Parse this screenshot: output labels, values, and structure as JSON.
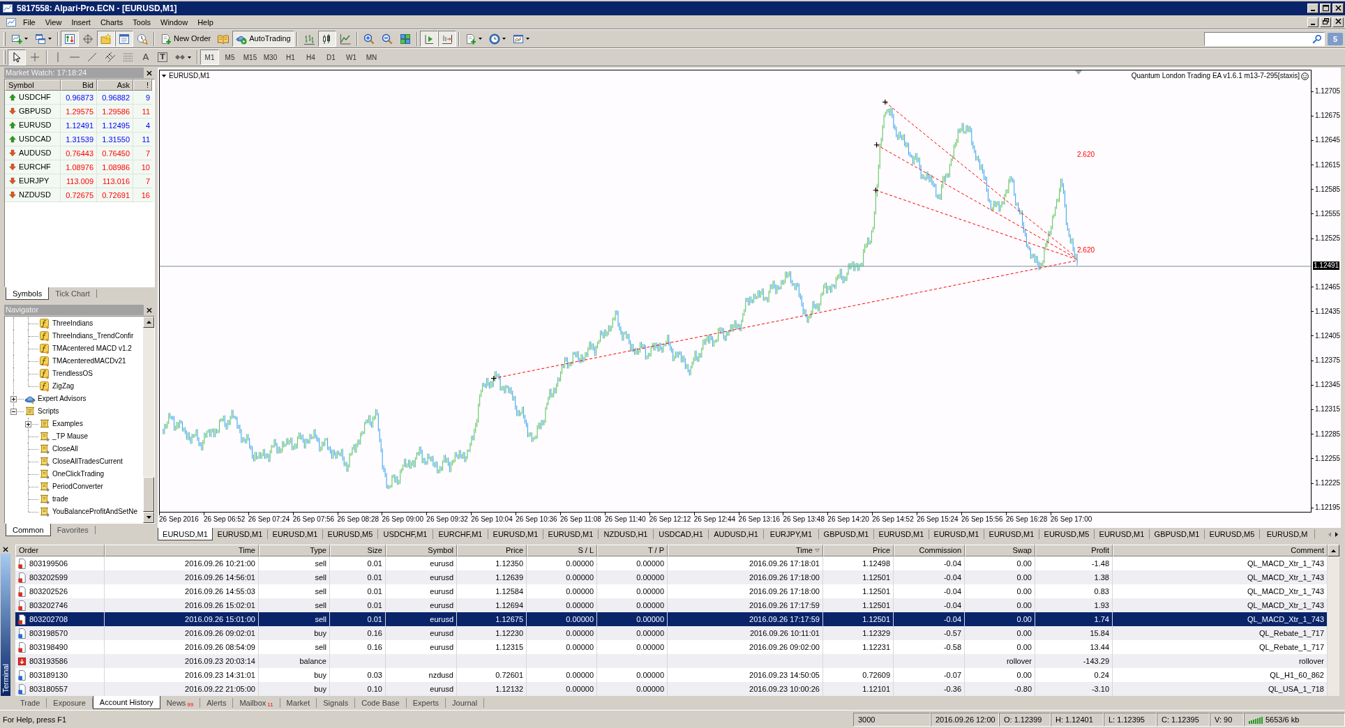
{
  "window": {
    "title": "5817558: Alpari-Pro.ECN - [EURUSD,M1]"
  },
  "menu": [
    "File",
    "View",
    "Insert",
    "Charts",
    "Tools",
    "Window",
    "Help"
  ],
  "toolbar_main": [
    [
      {
        "kind": "icon",
        "pressed": false,
        "dropdown": true
      },
      {
        "kind": "icon",
        "pressed": false,
        "dropdown": true
      }
    ],
    [
      {
        "kind": "icon",
        "pressed": true
      },
      {
        "kind": "icon",
        "pressed": false
      },
      {
        "kind": "icon",
        "pressed": true
      },
      {
        "kind": "icon",
        "pressed": true
      },
      {
        "kind": "icon",
        "pressed": false
      }
    ],
    [
      {
        "kind": "icon_text",
        "label": "New Order",
        "pressed": false
      },
      {
        "kind": "icon",
        "pressed": false
      },
      {
        "kind": "icon_text",
        "label": "AutoTrading",
        "pressed": true
      }
    ],
    [
      {
        "kind": "icon",
        "pressed": false
      },
      {
        "kind": "icon",
        "pressed": true
      },
      {
        "kind": "icon",
        "pressed": false
      }
    ],
    [
      {
        "kind": "icon",
        "pressed": false
      },
      {
        "kind": "icon",
        "pressed": false
      },
      {
        "kind": "icon",
        "pressed": false
      }
    ],
    [
      {
        "kind": "icon",
        "pressed": true
      },
      {
        "kind": "icon",
        "pressed": true
      }
    ],
    [
      {
        "kind": "icon",
        "pressed": false,
        "dropdown": true
      },
      {
        "kind": "icon",
        "pressed": false,
        "dropdown": true
      },
      {
        "kind": "icon",
        "pressed": false,
        "dropdown": true
      }
    ]
  ],
  "toolbar_draw": [
    [
      {
        "kind": "icon",
        "pressed": true
      },
      {
        "kind": "icon",
        "pressed": false
      }
    ],
    [
      {
        "kind": "icon",
        "pressed": false
      },
      {
        "kind": "icon",
        "pressed": false
      },
      {
        "kind": "icon",
        "pressed": false
      },
      {
        "kind": "icon",
        "pressed": false
      },
      {
        "kind": "icon",
        "pressed": false
      },
      {
        "kind": "glyph",
        "label": "A",
        "pressed": false
      },
      {
        "kind": "framed_glyph",
        "label": "T",
        "pressed": false
      },
      {
        "kind": "icon",
        "pressed": false,
        "dropdown": true
      }
    ]
  ],
  "timeframes": [
    {
      "label": "M1",
      "selected": true
    },
    {
      "label": "M5",
      "selected": false
    },
    {
      "label": "M15",
      "selected": false
    },
    {
      "label": "M30",
      "selected": false
    },
    {
      "label": "H1",
      "selected": false
    },
    {
      "label": "H4",
      "selected": false
    },
    {
      "label": "D1",
      "selected": false
    },
    {
      "label": "W1",
      "selected": false
    },
    {
      "label": "MN",
      "selected": false
    }
  ],
  "messages_count": "5",
  "market_watch": {
    "title": "Market Watch: 17:18:24",
    "columns": [
      "Symbol",
      "Bid",
      "Ask",
      "!"
    ],
    "rows": [
      {
        "symbol": "USDCHF",
        "bid": "0.96873",
        "ask": "0.96882",
        "spread": "9",
        "rising": true
      },
      {
        "symbol": "GBPUSD",
        "bid": "1.29575",
        "ask": "1.29586",
        "spread": "11",
        "rising": false
      },
      {
        "symbol": "EURUSD",
        "bid": "1.12491",
        "ask": "1.12495",
        "spread": "4",
        "rising": true
      },
      {
        "symbol": "USDCAD",
        "bid": "1.31539",
        "ask": "1.31550",
        "spread": "11",
        "rising": true
      },
      {
        "symbol": "AUDUSD",
        "bid": "0.76443",
        "ask": "0.76450",
        "spread": "7",
        "rising": false
      },
      {
        "symbol": "EURCHF",
        "bid": "1.08976",
        "ask": "1.08986",
        "spread": "10",
        "rising": false
      },
      {
        "symbol": "EURJPY",
        "bid": "113.009",
        "ask": "113.016",
        "spread": "7",
        "rising": false
      },
      {
        "symbol": "NZDUSD",
        "bid": "0.72675",
        "ask": "0.72691",
        "spread": "16",
        "rising": false
      }
    ],
    "tabs": [
      {
        "label": "Symbols",
        "selected": true
      },
      {
        "label": "Tick Chart",
        "selected": false
      }
    ]
  },
  "navigator": {
    "title": "Navigator",
    "tree": [
      {
        "children": [
          {
            "label": "ThreeIndians",
            "kind": "indicator"
          },
          {
            "label": "ThreeIndians_TrendConfir",
            "kind": "indicator"
          },
          {
            "label": "TMAcentered MACD v1.2",
            "kind": "indicator"
          },
          {
            "label": "TMAcenteredMACDv21",
            "kind": "indicator"
          },
          {
            "label": "TrendlessOS",
            "kind": "indicator"
          },
          {
            "label": "ZigZag",
            "kind": "indicator"
          }
        ]
      },
      {
        "label": "Expert Advisors",
        "kind": "experts",
        "expanded": false
      },
      {
        "label": "Scripts",
        "kind": "folder",
        "expanded": true,
        "children": [
          {
            "label": "Examples",
            "kind": "folder",
            "expanded": false
          },
          {
            "label": "_TP Mause",
            "kind": "script"
          },
          {
            "label": "CloseAll",
            "kind": "script"
          },
          {
            "label": "CloseAllTradesCurrent",
            "kind": "script"
          },
          {
            "label": "OneClickTrading",
            "kind": "script"
          },
          {
            "label": "PeriodConverter",
            "kind": "script"
          },
          {
            "label": "trade",
            "kind": "script"
          },
          {
            "label": "YouBalanceProfitAndSetNe",
            "kind": "script"
          }
        ]
      }
    ],
    "tabs": [
      {
        "label": "Common",
        "selected": true
      },
      {
        "label": "Favorites",
        "selected": false
      }
    ]
  },
  "chart": {
    "symbol_label": "EURUSD,M1",
    "ea_label": "Quantum London Trading EA v1.6.1 m13-7-295[staxis]",
    "price_labels_above": [
      "1.12705",
      "1.12675",
      "1.12645",
      "1.12615",
      "1.12585",
      "1.12555",
      "1.12525"
    ],
    "bid_label": "1.12491",
    "price_labels_below": [
      "1.12465",
      "1.12435",
      "1.12405",
      "1.12375",
      "1.12345",
      "1.12315",
      "1.12285",
      "1.12255",
      "1.12225",
      "1.12195"
    ],
    "time_labels": [
      "26 Sep 2016",
      "26 Sep 06:52",
      "26 Sep 07:24",
      "26 Sep 07:56",
      "26 Sep 08:28",
      "26 Sep 09:00",
      "26 Sep 09:32",
      "26 Sep 10:04",
      "26 Sep 10:36",
      "26 Sep 11:08",
      "26 Sep 11:40",
      "26 Sep 12:12",
      "26 Sep 12:44",
      "26 Sep 13:16",
      "26 Sep 13:48",
      "26 Sep 14:20",
      "26 Sep 14:52",
      "26 Sep 15:24",
      "26 Sep 15:56",
      "26 Sep 16:28",
      "26 Sep 17:00"
    ],
    "fibo_labels": [
      "2.620",
      "2.620"
    ]
  },
  "chart_tabs": [
    {
      "label": "EURUSD,M1",
      "selected": true
    },
    {
      "label": "EURUSD,M1",
      "selected": false
    },
    {
      "label": "EURUSD,M1",
      "selected": false
    },
    {
      "label": "EURUSD,M5",
      "selected": false
    },
    {
      "label": "USDCHF,M1",
      "selected": false
    },
    {
      "label": "EURCHF,M1",
      "selected": false
    },
    {
      "label": "EURUSD,M1",
      "selected": false
    },
    {
      "label": "EURUSD,M1",
      "selected": false
    },
    {
      "label": "NZDUSD,H1",
      "selected": false
    },
    {
      "label": "USDCAD,H1",
      "selected": false
    },
    {
      "label": "AUDUSD,H1",
      "selected": false
    },
    {
      "label": "EURJPY,M1",
      "selected": false
    },
    {
      "label": "GBPUSD,M1",
      "selected": false
    },
    {
      "label": "EURUSD,M1",
      "selected": false
    },
    {
      "label": "EURUSD,M1",
      "selected": false
    },
    {
      "label": "EURUSD,M1",
      "selected": false
    },
    {
      "label": "EURUSD,M5",
      "selected": false
    },
    {
      "label": "EURUSD,M1",
      "selected": false
    },
    {
      "label": "GBPUSD,M1",
      "selected": false
    },
    {
      "label": "EURUSD,M5",
      "selected": false
    },
    {
      "label": "EURUSD,M",
      "selected": false
    }
  ],
  "terminal": {
    "side_label": "Terminal",
    "columns": [
      {
        "label": "Order",
        "sorted": false
      },
      {
        "label": "Time",
        "sorted": false
      },
      {
        "label": "Type",
        "sorted": false
      },
      {
        "label": "Size",
        "sorted": false
      },
      {
        "label": "Symbol",
        "sorted": false
      },
      {
        "label": "Price",
        "sorted": false
      },
      {
        "label": "S / L",
        "sorted": false
      },
      {
        "label": "T / P",
        "sorted": false
      },
      {
        "label": "Time",
        "sorted": true
      },
      {
        "label": "Price",
        "sorted": false
      },
      {
        "label": "Commission",
        "sorted": false
      },
      {
        "label": "Swap",
        "sorted": false
      },
      {
        "label": "Profit",
        "sorted": false
      },
      {
        "label": "Comment",
        "sorted": false
      }
    ],
    "rows": [
      {
        "kind": "sell",
        "selected": false,
        "cells": [
          "803199506",
          "2016.09.26 10:21:00",
          "sell",
          "0.01",
          "eurusd",
          "1.12350",
          "0.00000",
          "0.00000",
          "2016.09.26 17:18:01",
          "1.12498",
          "-0.04",
          "0.00",
          "-1.48",
          "QL_MACD_Xtr_1_743"
        ]
      },
      {
        "kind": "sell",
        "selected": false,
        "cells": [
          "803202599",
          "2016.09.26 14:56:01",
          "sell",
          "0.01",
          "eurusd",
          "1.12639",
          "0.00000",
          "0.00000",
          "2016.09.26 17:18:00",
          "1.12501",
          "-0.04",
          "0.00",
          "1.38",
          "QL_MACD_Xtr_1_743"
        ]
      },
      {
        "kind": "sell",
        "selected": false,
        "cells": [
          "803202526",
          "2016.09.26 14:55:03",
          "sell",
          "0.01",
          "eurusd",
          "1.12584",
          "0.00000",
          "0.00000",
          "2016.09.26 17:18:00",
          "1.12501",
          "-0.04",
          "0.00",
          "0.83",
          "QL_MACD_Xtr_1_743"
        ]
      },
      {
        "kind": "sell",
        "selected": false,
        "cells": [
          "803202746",
          "2016.09.26 15:02:01",
          "sell",
          "0.01",
          "eurusd",
          "1.12694",
          "0.00000",
          "0.00000",
          "2016.09.26 17:17:59",
          "1.12501",
          "-0.04",
          "0.00",
          "1.93",
          "QL_MACD_Xtr_1_743"
        ]
      },
      {
        "kind": "sell",
        "selected": true,
        "cells": [
          "803202708",
          "2016.09.26 15:01:00",
          "sell",
          "0.01",
          "eurusd",
          "1.12675",
          "0.00000",
          "0.00000",
          "2016.09.26 17:17:59",
          "1.12501",
          "-0.04",
          "0.00",
          "1.74",
          "QL_MACD_Xtr_1_743"
        ]
      },
      {
        "kind": "buy",
        "selected": false,
        "cells": [
          "803198570",
          "2016.09.26 09:02:01",
          "buy",
          "0.16",
          "eurusd",
          "1.12230",
          "0.00000",
          "0.00000",
          "2016.09.26 10:11:01",
          "1.12329",
          "-0.57",
          "0.00",
          "15.84",
          "QL_Rebate_1_717"
        ]
      },
      {
        "kind": "sell",
        "selected": false,
        "cells": [
          "803198490",
          "2016.09.26 08:54:09",
          "sell",
          "0.16",
          "eurusd",
          "1.12315",
          "0.00000",
          "0.00000",
          "2016.09.26 09:02:00",
          "1.12231",
          "-0.58",
          "0.00",
          "13.44",
          "QL_Rebate_1_717"
        ]
      },
      {
        "kind": "balance",
        "selected": false,
        "cells": [
          "803193586",
          "2016.09.23 20:03:14",
          "balance",
          null,
          null,
          null,
          null,
          null,
          null,
          null,
          null,
          "rollover",
          "-143.29",
          "rollover"
        ]
      },
      {
        "kind": "buy",
        "selected": false,
        "cells": [
          "803189130",
          "2016.09.23 14:31:01",
          "buy",
          "0.03",
          "nzdusd",
          "0.72601",
          "0.00000",
          "0.00000",
          "2016.09.23 14:50:05",
          "0.72609",
          "-0.07",
          "0.00",
          "0.24",
          "QL_H1_60_862"
        ]
      },
      {
        "kind": "buy",
        "selected": false,
        "cells": [
          "803180557",
          "2016.09.22 21:05:00",
          "buy",
          "0.10",
          "eurusd",
          "1.12132",
          "0.00000",
          "0.00000",
          "2016.09.23 10:00:26",
          "1.12101",
          "-0.36",
          "-0.80",
          "-3.10",
          "QL_USA_1_718"
        ]
      }
    ],
    "tabs": [
      {
        "label": "Trade",
        "selected": false
      },
      {
        "label": "Exposure",
        "selected": false
      },
      {
        "label": "Account History",
        "selected": true
      },
      {
        "label": "News",
        "badge": "99",
        "selected": false
      },
      {
        "label": "Alerts",
        "selected": false
      },
      {
        "label": "Mailbox",
        "badge": "11",
        "selected": false
      },
      {
        "label": "Market",
        "selected": false
      },
      {
        "label": "Signals",
        "selected": false
      },
      {
        "label": "Code Base",
        "selected": false
      },
      {
        "label": "Experts",
        "selected": false
      },
      {
        "label": "Journal",
        "selected": false
      }
    ]
  },
  "status_bar": {
    "help": "For Help, press F1",
    "panes": [
      "3000",
      "2016.09.26 12:00",
      "O: 1.12399",
      "H: 1.12401",
      "L: 1.12395",
      "C: 1.12395",
      "V: 90"
    ],
    "traffic": "5653/6 kb"
  }
}
